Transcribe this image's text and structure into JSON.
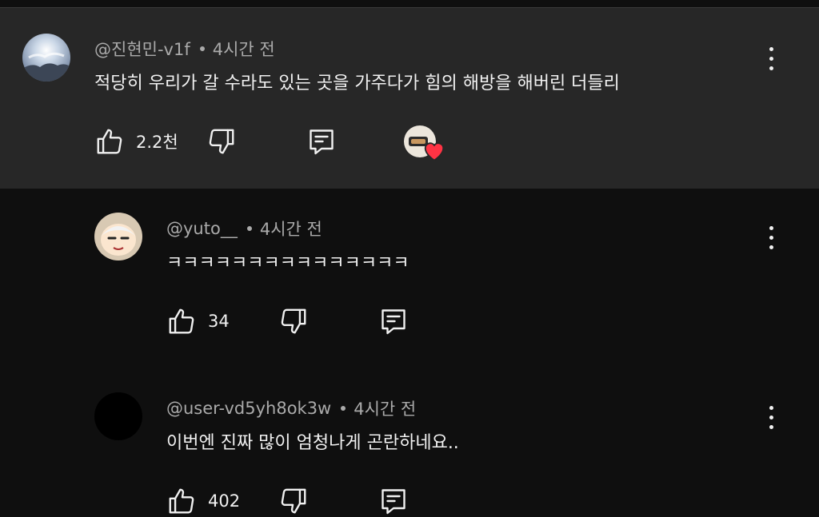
{
  "comments": [
    {
      "author": "@진현민-v1f",
      "time": "4시간 전",
      "text": "적당히 우리가 갈 수라도 있는 곳을 가주다가 힘의 해방을 해버린 더들리",
      "likes": "2.2천"
    },
    {
      "author": "@yuto__",
      "time": "4시간 전",
      "text": "ㅋㅋㅋㅋㅋㅋㅋㅋㅋㅋㅋㅋㅋㅋㅋ",
      "likes": "34"
    },
    {
      "author": "@user-vd5yh8ok3w",
      "time": "4시간 전",
      "text": "이번엔 진짜 많이 엄청나게 곤란하네요..",
      "likes": "402"
    }
  ],
  "icons": {
    "like": "thumbs-up-icon",
    "dislike": "thumbs-down-icon",
    "reply": "reply-icon",
    "more": "more-vert-icon",
    "heart": "creator-heart-icon"
  },
  "colors": {
    "background": "#0f0f0f",
    "highlight_background": "#272727",
    "text_primary": "#f1f1f1",
    "text_secondary": "#aaaaaa",
    "heart": "#ff3344"
  }
}
